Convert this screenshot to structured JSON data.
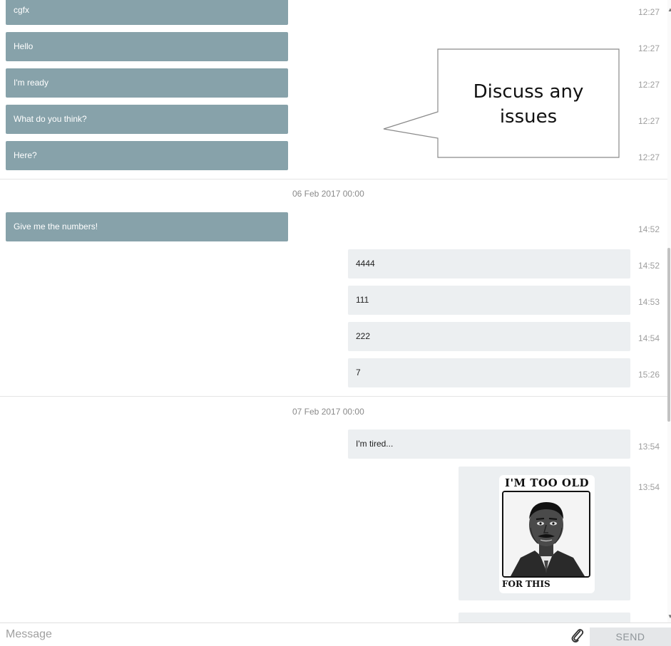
{
  "conversation": {
    "messages_top": [
      {
        "text": "cgfx",
        "time": "12:27"
      },
      {
        "text": "Hello",
        "time": "12:27"
      },
      {
        "text": "I'm ready",
        "time": "12:27"
      },
      {
        "text": "What do you think?",
        "time": "12:27"
      },
      {
        "text": "Here?",
        "time": "12:27"
      }
    ],
    "date_sep_1": "06 Feb 2017 00:00",
    "group_2_incoming": {
      "text": "Give me the numbers!",
      "time": "14:52"
    },
    "group_2_outgoing": [
      {
        "text": "4444",
        "time": "14:52"
      },
      {
        "text": "111",
        "time": "14:53"
      },
      {
        "text": "222",
        "time": "14:54"
      },
      {
        "text": "7",
        "time": "15:26"
      }
    ],
    "date_sep_2": "07 Feb 2017 00:00",
    "group_3_outgoing": {
      "text": "I'm tired...",
      "time": "13:54"
    },
    "image_message": {
      "time": "13:54",
      "meme_top_text": "I'M TOO OLD",
      "meme_bottom_text": "FOR THIS"
    }
  },
  "callout": {
    "line1": "Discuss any",
    "line2": "issues"
  },
  "composer": {
    "placeholder": "Message",
    "send_label": "SEND",
    "attach_icon": "paperclip-icon"
  },
  "colors": {
    "incoming_bubble": "#87a2aa",
    "outgoing_bubble": "#eceff1"
  }
}
